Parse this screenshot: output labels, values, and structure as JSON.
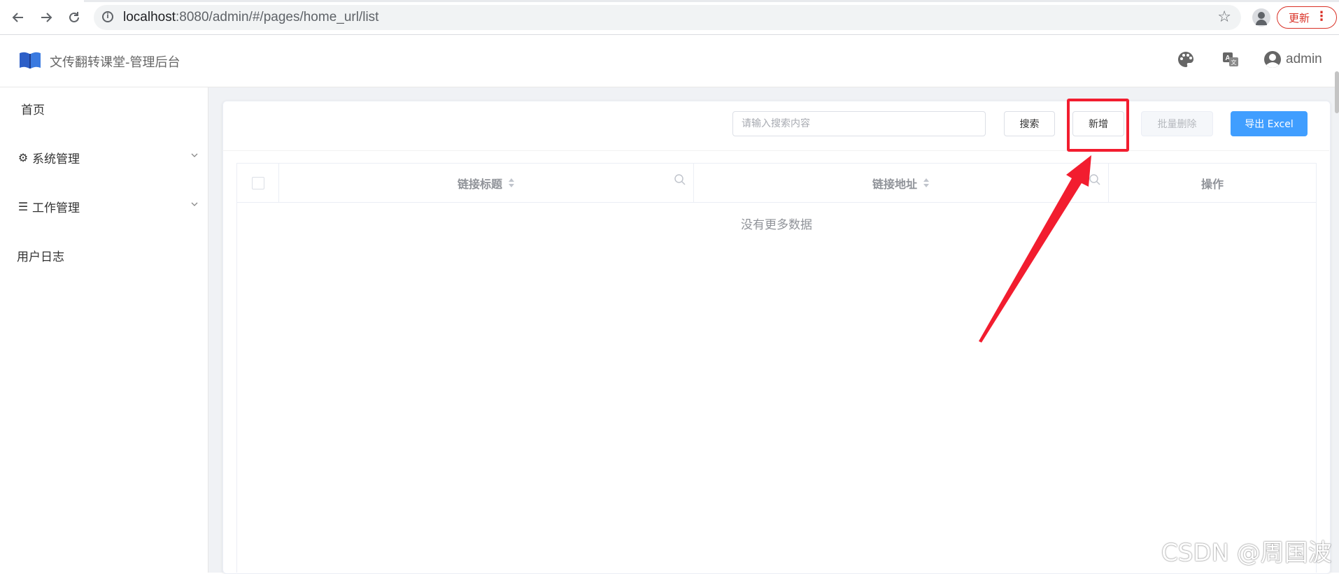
{
  "browser": {
    "url_host": "localhost",
    "url_path": ":8080/admin/#/pages/home_url/list",
    "update_label": "更新",
    "back_icon": "arrow-left-icon",
    "forward_icon": "arrow-right-icon",
    "reload_icon": "reload-icon"
  },
  "header": {
    "title": "文传翻转课堂-管理后台",
    "user_name": "admin",
    "icons": [
      "palette-icon",
      "translate-icon",
      "user-avatar-icon"
    ]
  },
  "sidebar": {
    "items": [
      {
        "label": "首页",
        "icon": "",
        "expandable": false
      },
      {
        "label": "系统管理",
        "icon": "gear-icon",
        "expandable": true
      },
      {
        "label": "工作管理",
        "icon": "list-icon",
        "expandable": true
      },
      {
        "label": "用户日志",
        "icon": "",
        "expandable": false
      }
    ]
  },
  "toolbar": {
    "search_placeholder": "请输入搜索内容",
    "search_value": "",
    "search_label": "搜索",
    "add_label": "新增",
    "batch_delete_label": "批量删除",
    "export_label": "导出 Excel"
  },
  "table": {
    "columns": [
      "链接标题",
      "链接地址",
      "操作"
    ],
    "rows": [],
    "empty_text": "没有更多数据"
  },
  "colors": {
    "primary": "#409eff",
    "annotation": "#f21d2f",
    "logo_blue": "#3a6fd8"
  },
  "watermark": "CSDN @周国波"
}
